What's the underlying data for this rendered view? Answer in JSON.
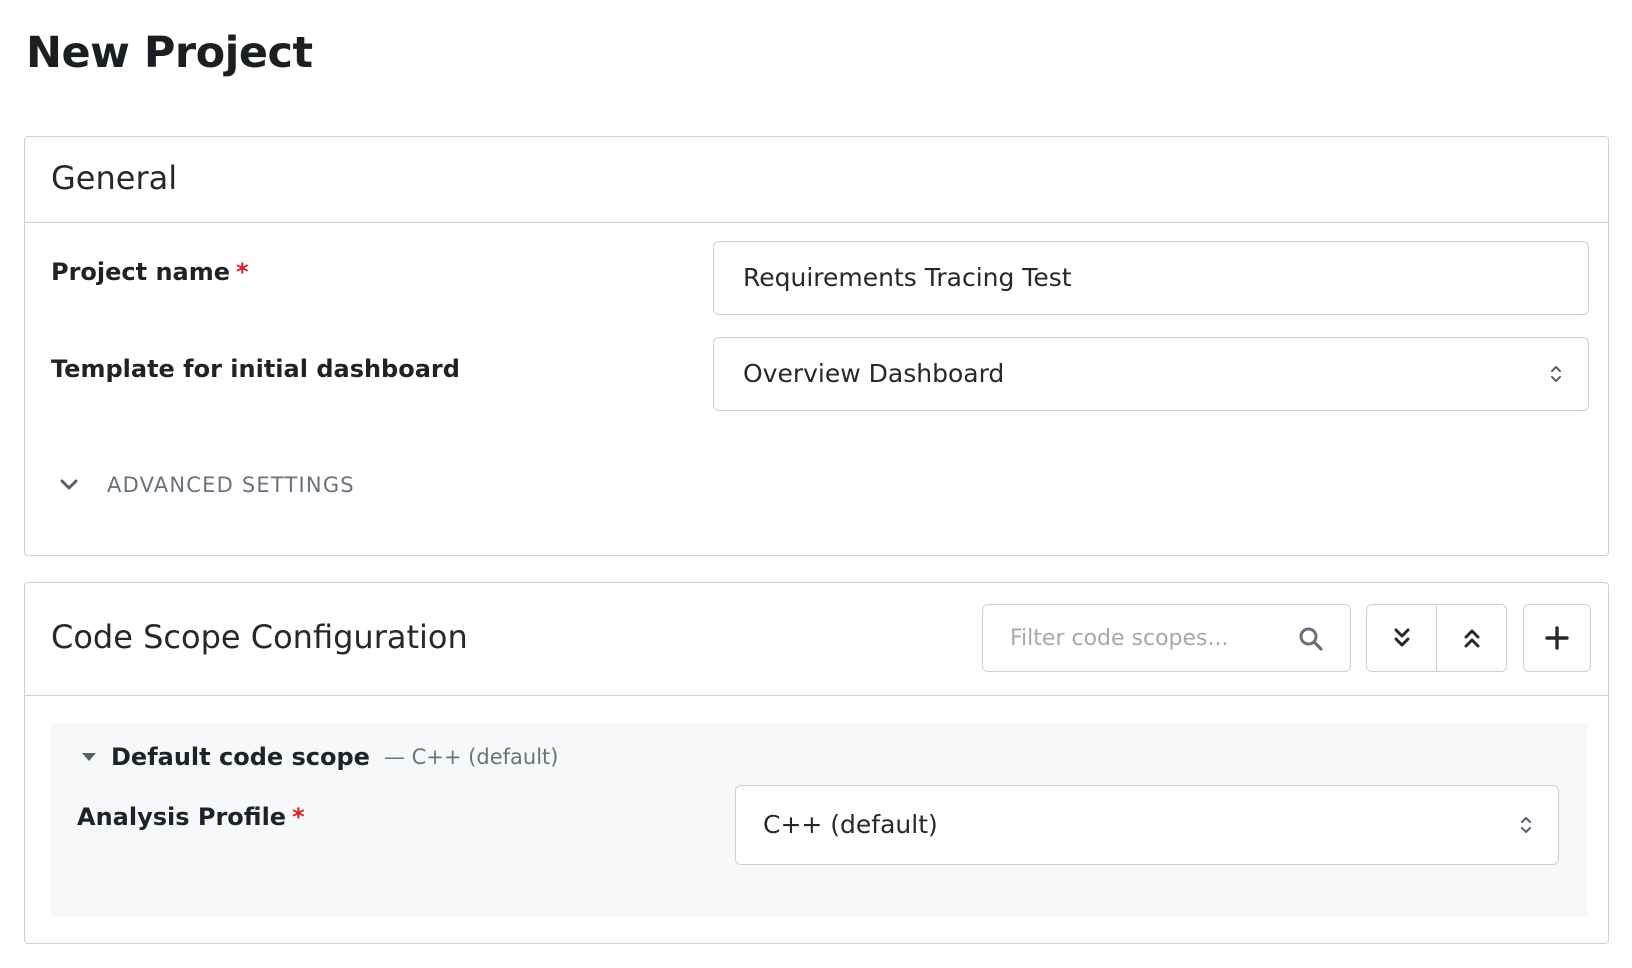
{
  "page": {
    "title": "New Project"
  },
  "general": {
    "title": "General",
    "project_name": {
      "label": "Project name",
      "required": "*",
      "value": "Requirements Tracing Test"
    },
    "template": {
      "label": "Template for initial dashboard",
      "value": "Overview Dashboard"
    },
    "advanced": {
      "label": "ADVANCED SETTINGS",
      "icon": "chevron-down-icon"
    }
  },
  "code_scope": {
    "title": "Code Scope Configuration",
    "filter": {
      "placeholder": "Filter code scopes...",
      "icon": "search-icon"
    },
    "buttons": {
      "expand_all_icon": "double-chevron-down-icon",
      "collapse_all_icon": "double-chevron-up-icon",
      "add_icon": "plus-icon"
    },
    "scope": {
      "name": "Default code scope",
      "subtitle": "— C++ (default)",
      "analysis_profile": {
        "label": "Analysis Profile",
        "required": "*",
        "value": "C++ (default)"
      }
    }
  },
  "colors": {
    "required": "#d3202b",
    "border": "#cdd1d6",
    "panel_bg": "#f6f8fa",
    "muted_text": "#6a737d"
  }
}
